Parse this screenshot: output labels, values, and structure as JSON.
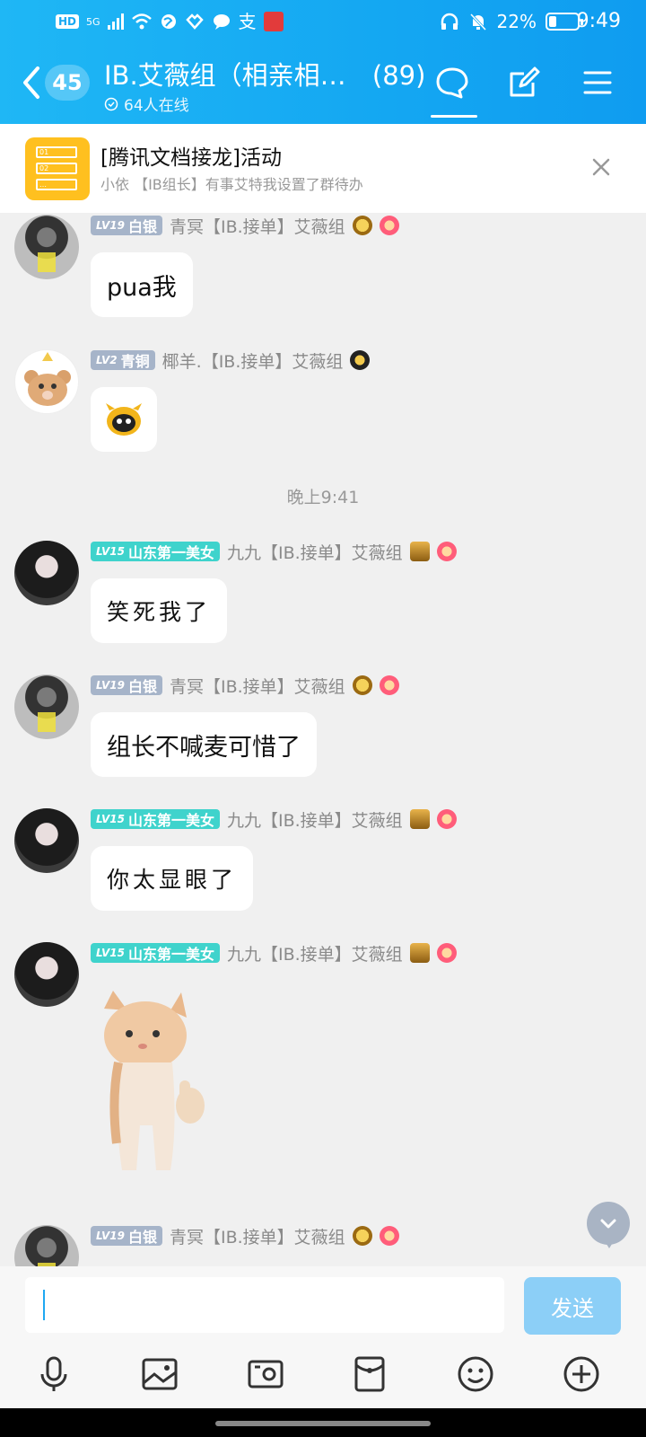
{
  "status_bar": {
    "hd": "HD",
    "net": "5G",
    "alipay": "支",
    "battery": "22%",
    "time": "9:49"
  },
  "header": {
    "unread_count": "45",
    "title": "IB.艾薇组（相亲相…",
    "member_count": "(89)",
    "online": "64人在线"
  },
  "banner": {
    "icon_rows": [
      "01",
      "02",
      "…"
    ],
    "title": "[腾讯文档接龙]活动",
    "subtitle": "小依 【IB组长】有事艾特我设置了群待办"
  },
  "messages": [
    {
      "level_num": "LV19",
      "level_name": "白银",
      "nick": "青冥【IB.接单】艾薇组",
      "text": "pua我"
    },
    {
      "level_num": "LV2",
      "level_name": "青铜",
      "nick": "椰羊.【IB.接单】艾薇组",
      "text": ""
    },
    {
      "level_num": "LV15",
      "level_name": "山东第一美女",
      "nick": "九九【IB.接单】艾薇组",
      "text": "笑死我了"
    },
    {
      "level_num": "LV19",
      "level_name": "白银",
      "nick": "青冥【IB.接单】艾薇组",
      "text": "组长不喊麦可惜了"
    },
    {
      "level_num": "LV15",
      "level_name": "山东第一美女",
      "nick": "九九【IB.接单】艾薇组",
      "text": "你太显眼了"
    },
    {
      "level_num": "LV15",
      "level_name": "山东第一美女",
      "nick": "九九【IB.接单】艾薇组",
      "text": ""
    },
    {
      "level_num": "LV19",
      "level_name": "白银",
      "nick": "青冥【IB.接单】艾薇组",
      "text": ""
    }
  ],
  "timestamp": "晚上9:41",
  "input": {
    "placeholder": "",
    "send_label": "发送"
  },
  "colors": {
    "header_blue": "#14a7f2",
    "level_teal": "#3fd3cc",
    "level_gray": "#a6b4c9",
    "send_disabled": "#8ccff7"
  }
}
